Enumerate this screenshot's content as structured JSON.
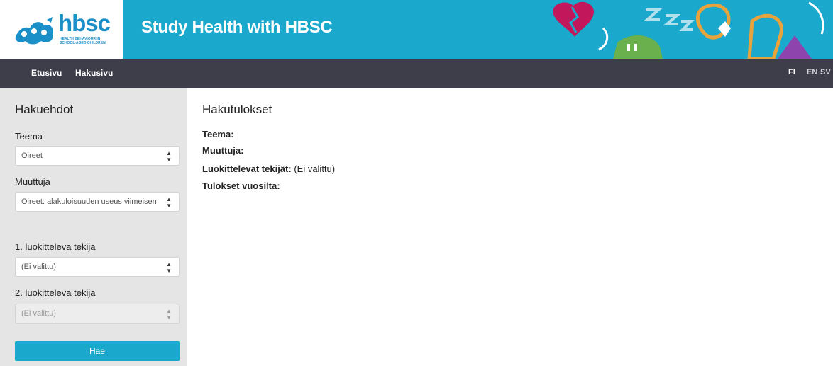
{
  "header": {
    "logo_text": "hbsc",
    "logo_subtitle": "HEALTH BEHAVIOUR IN SCHOOL-AGED CHILDREN",
    "site_title": "Study Health with HBSC",
    "colors": {
      "brand": "#1aa8cc",
      "nav": "#3e3e4a"
    }
  },
  "nav": {
    "items": [
      {
        "label": "Etusivu"
      },
      {
        "label": "Hakusivu"
      }
    ],
    "languages": [
      {
        "label": "FI",
        "active": true
      },
      {
        "label": "EN",
        "active": false
      },
      {
        "label": "SV",
        "active": false
      }
    ]
  },
  "sidebar": {
    "title": "Hakuehdot",
    "theme": {
      "label": "Teema",
      "value": "Oireet"
    },
    "variable": {
      "label": "Muuttuja",
      "value": "Oireet: alakuloisuuden useus viimeisen"
    },
    "factor1": {
      "label": "1. luokitteleva tekijä",
      "value": "(Ei valittu)"
    },
    "factor2": {
      "label": "2. luokitteleva tekijä",
      "value": "(Ei valittu)"
    },
    "search_button": "Hae"
  },
  "main": {
    "title": "Hakutulokset",
    "results": {
      "theme_label": "Teema:",
      "variable_label": "Muuttuja:",
      "factors_label": "Luokittelevat tekijät:",
      "factors_value": " (Ei valittu)",
      "years_label": "Tulokset vuosilta:"
    }
  }
}
